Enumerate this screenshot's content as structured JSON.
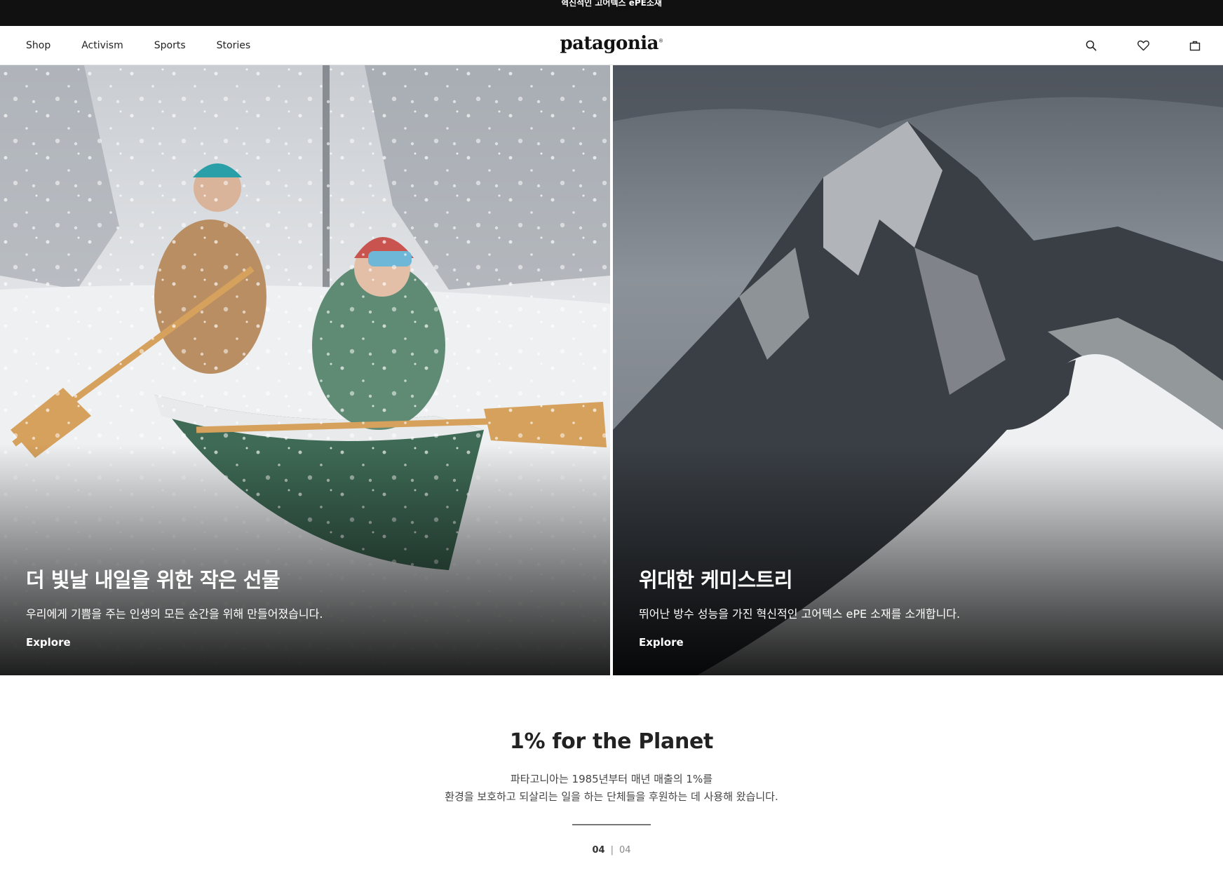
{
  "promo": {
    "text": "혁신적인 고어텍스 ePE소재"
  },
  "nav": {
    "items": [
      "Shop",
      "Activism",
      "Sports",
      "Stories"
    ]
  },
  "logo": {
    "text": "patagonia",
    "mark": "®"
  },
  "header_icons": [
    "search-icon",
    "heart-icon",
    "bag-icon"
  ],
  "hero_left": {
    "title": "더 빛날 내일을 위한 작은 선물",
    "desc": "우리에게 기쁨을 주는 인생의 모든 순간을 위해 만들어졌습니다.",
    "cta": "Explore"
  },
  "hero_right": {
    "title": "위대한 케미스트리",
    "desc": "뛰어난 방수 성능을 가진 혁신적인 고어텍스 ePE 소재를 소개합니다.",
    "cta": "Explore"
  },
  "planet": {
    "title": "1% for the Planet",
    "line1": "파타고니아는 1985년부터 매년 매출의 1%를",
    "line2": "환경을 보호하고 되살리는 일을 하는 단체들을 후원하는 데 사용해 왔습니다.",
    "progress": 1.0
  },
  "pager": {
    "current": "04",
    "separator": "|",
    "total": "04"
  },
  "colors": {
    "topbar": "#111111",
    "text": "#222222"
  }
}
